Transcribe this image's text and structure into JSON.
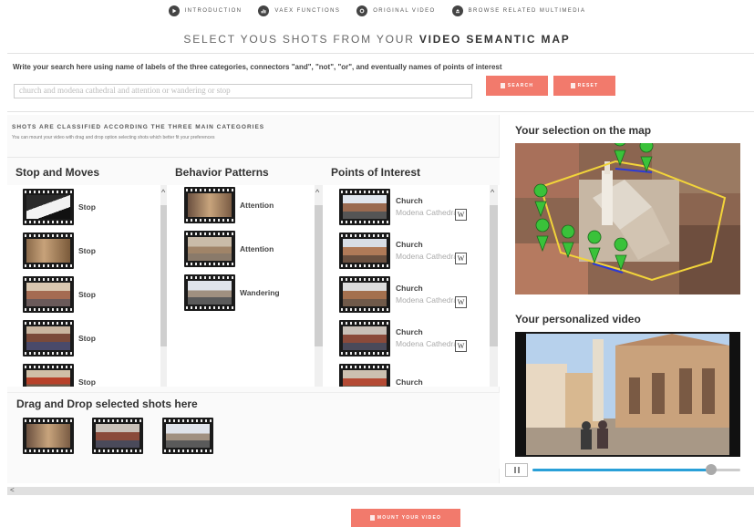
{
  "nav": [
    {
      "label": "INTRODUCTION",
      "icon": "play-icon"
    },
    {
      "label": "VAEX FUNCTIONS",
      "icon": "chart-icon"
    },
    {
      "label": "ORIGINAL VIDEO",
      "icon": "record-icon"
    },
    {
      "label": "BROWSE RELATED MULTIMEDIA",
      "icon": "eject-icon"
    }
  ],
  "heading": {
    "part1": "SELECT YOUS SHOTS FROM YOUR ",
    "bold1": "VIDEO",
    "part2": " ",
    "bold2": "SEMANTIC MAP"
  },
  "search": {
    "instructions": "Write your search here using name of labels of the three categories, connectors \"and\", \"not\", \"or\", and eventually names of points of interest",
    "value": "church and modena cathedral and attention or wandering or stop",
    "search_label": "SEARCH",
    "reset_label": "RESET"
  },
  "shots_panel": {
    "title": "SHOTS ARE CLASSIFIED ACCORDING THE THREE MAIN CATEGORIES",
    "subtitle": "You can mount your video with drag and drop option selecting shots which better fit your preferences"
  },
  "columns": {
    "stop_moves": {
      "title": "Stop and Moves",
      "items": [
        "Stop",
        "Stop",
        "Stop",
        "Stop",
        "Stop"
      ]
    },
    "behavior": {
      "title": "Behavior Patterns",
      "items": [
        "Attention",
        "Attention",
        "Wandering"
      ]
    },
    "poi": {
      "title": "Points of Interest",
      "items": [
        {
          "name": "Church",
          "place": "Modena Cathedral",
          "wiki": "W"
        },
        {
          "name": "Church",
          "place": "Modena Cathedral",
          "wiki": "W"
        },
        {
          "name": "Church",
          "place": "Modena Cathedral",
          "wiki": "W"
        },
        {
          "name": "Church",
          "place": "Modena Cathedral",
          "wiki": "W"
        },
        {
          "name": "Church",
          "place": "",
          "wiki": ""
        }
      ]
    }
  },
  "drag": {
    "title": "Drag and Drop selected shots here"
  },
  "map_panel": {
    "title": "Your selection on the map"
  },
  "video_panel": {
    "title": "Your personalized video",
    "progress": 0.86
  },
  "mount": {
    "label": "MOUNT YOUR VIDEO"
  },
  "hscroll": {
    "arrow": "<"
  },
  "colors": {
    "accent": "#f27a6c",
    "progress": "#29a0d8",
    "route": "#f2d43a",
    "marker": "#3ac23a"
  }
}
